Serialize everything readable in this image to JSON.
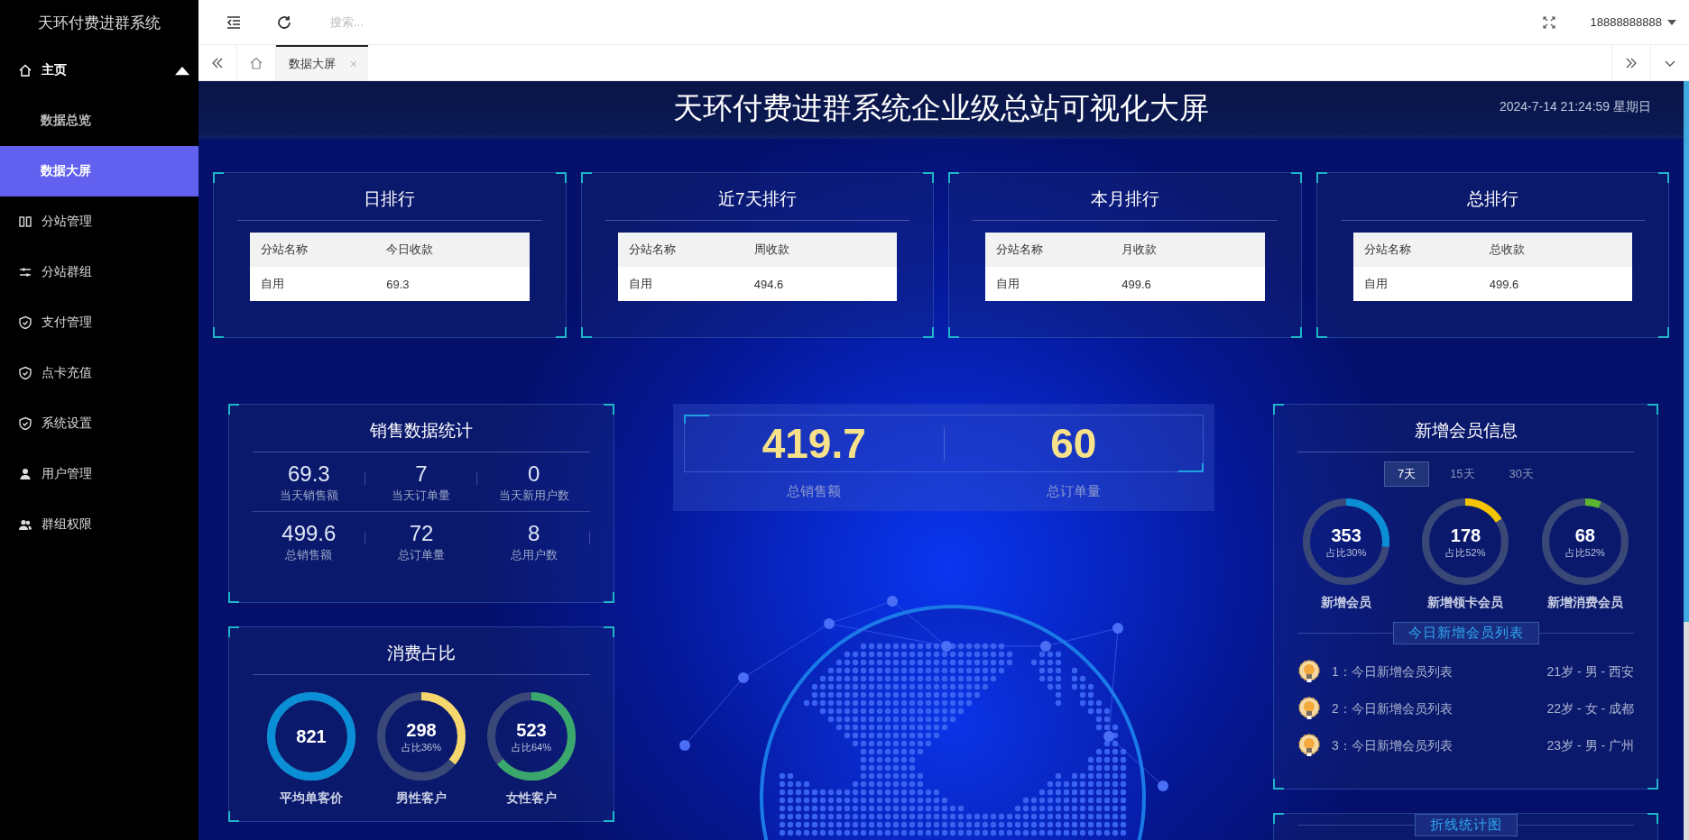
{
  "sidebar": {
    "title": "天环付费进群系统",
    "items": [
      {
        "label": "主页",
        "kind": "group",
        "expanded": true,
        "children": [
          {
            "label": "数据总览",
            "selected": false
          },
          {
            "label": "数据大屏",
            "selected": true
          }
        ]
      },
      {
        "label": "分站管理",
        "kind": "link"
      },
      {
        "label": "分站群组",
        "kind": "link"
      },
      {
        "label": "支付管理",
        "kind": "link"
      },
      {
        "label": "点卡充值",
        "kind": "link"
      },
      {
        "label": "系统设置",
        "kind": "link"
      },
      {
        "label": "用户管理",
        "kind": "link"
      },
      {
        "label": "群组权限",
        "kind": "link"
      }
    ]
  },
  "topbar": {
    "search": {
      "placeholder": "搜索..."
    },
    "user": "18888888888"
  },
  "tabs": [
    {
      "label": "数据大屏",
      "selected": true
    }
  ],
  "dashboard": {
    "title": "天环付费进群系统企业级总站可视化大屏",
    "datetime": "2024-7-14 21:24:59 星期日",
    "rankings": [
      {
        "title": "日排行",
        "columns": [
          "分站名称",
          "今日收款"
        ],
        "rows": [
          [
            "自用",
            "69.3"
          ]
        ]
      },
      {
        "title": "近7天排行",
        "columns": [
          "分站名称",
          "周收款"
        ],
        "rows": [
          [
            "自用",
            "494.6"
          ]
        ]
      },
      {
        "title": "本月排行",
        "columns": [
          "分站名称",
          "月收款"
        ],
        "rows": [
          [
            "自用",
            "499.6"
          ]
        ]
      },
      {
        "title": "总排行",
        "columns": [
          "分站名称",
          "总收款"
        ],
        "rows": [
          [
            "自用",
            "499.6"
          ]
        ]
      }
    ],
    "sales": {
      "title": "销售数据统计",
      "stats": [
        {
          "value": "69.3",
          "label": "当天销售额"
        },
        {
          "value": "7",
          "label": "当天订单量"
        },
        {
          "value": "0",
          "label": "当天新用户数"
        },
        {
          "value": "499.6",
          "label": "总销售额"
        },
        {
          "value": "72",
          "label": "总订单量"
        },
        {
          "value": "8",
          "label": "总用户数"
        }
      ]
    },
    "consumption": {
      "title": "消费占比",
      "gauges": [
        {
          "value": "821",
          "label": "平均单客价",
          "level": 1,
          "color": "#0a8fd6"
        },
        {
          "value": "298",
          "sub": "占比36%",
          "label": "男性客户",
          "level": 0.36,
          "color": "#f5d76e"
        },
        {
          "value": "523",
          "sub": "占比64%",
          "label": "女性客户",
          "level": 0.64,
          "color": "#3aa76d"
        }
      ]
    },
    "totals": [
      {
        "value": "419.7",
        "label": "总销售额"
      },
      {
        "value": "60",
        "label": "总订单量"
      }
    ],
    "members": {
      "title": "新增会员信息",
      "periods": [
        {
          "label": "7天",
          "selected": true
        },
        {
          "label": "15天",
          "selected": false
        },
        {
          "label": "30天",
          "selected": false
        }
      ],
      "gauges": [
        {
          "value": "353",
          "sub": "占比30%",
          "label": "新增会员",
          "level": 0.27,
          "color": "#0a8fd6"
        },
        {
          "value": "178",
          "sub": "占比52%",
          "label": "新增领卡会员",
          "level": 0.16,
          "color": "#f5c400"
        },
        {
          "value": "68",
          "sub": "占比52%",
          "label": "新增消费会员",
          "level": 0.06,
          "color": "#5cb531"
        }
      ],
      "list_title": "今日新增会员列表",
      "list": [
        {
          "name": "1：今日新增会员列表",
          "info": "21岁 - 男 - 西安"
        },
        {
          "name": "2：今日新增会员列表",
          "info": "22岁 - 女 - 成都"
        },
        {
          "name": "3：今日新增会员列表",
          "info": "23岁 - 男 - 广州"
        }
      ]
    },
    "line_chart": {
      "title": "折线统计图"
    }
  }
}
